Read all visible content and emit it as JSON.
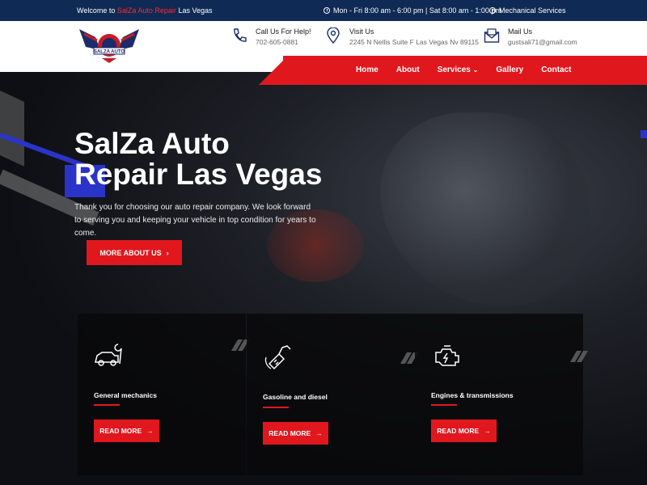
{
  "topbar": {
    "welcome_prefix": "Welcome to",
    "welcome_brand": "SalZa Auto Repair",
    "welcome_suffix": "Las Vegas",
    "hours": "Mon - Fri 8:00 am - 6:00 pm | Sat 8:00 am - 1:00 pm",
    "services": "Mechanical Services"
  },
  "header": {
    "logo_text": "SALZA AUTO",
    "call_title": "Call Us For Help!",
    "call_value": "702-605-0881",
    "visit_title": "Visit Us",
    "visit_value": "2245 N Nellis Suite F Las Vegas Nv 89115",
    "mail_title": "Mail Us",
    "mail_value": "gustsali71@gmail.com"
  },
  "nav": {
    "items": [
      "Home",
      "About",
      "Services",
      "Gallery",
      "Contact"
    ]
  },
  "hero": {
    "title_line1": "SalZa Auto",
    "title_line2": "Repair Las Vegas",
    "text": "Thank you for choosing our auto repair company. We look forward to serving you and keeping your vehicle in top condition for years to come.",
    "button": "MORE ABOUT US"
  },
  "cards": [
    {
      "label": "General mechanics",
      "button": "READ MORE",
      "icon": "car-wrench-icon"
    },
    {
      "label": "Gasoline and diesel",
      "button": "READ MORE",
      "icon": "fuel-pump-icon"
    },
    {
      "label": "Engines & transmissions",
      "button": "READ MORE",
      "icon": "engine-icon"
    }
  ],
  "colors": {
    "accent": "#e1171e",
    "topbar": "#0f2a55"
  }
}
